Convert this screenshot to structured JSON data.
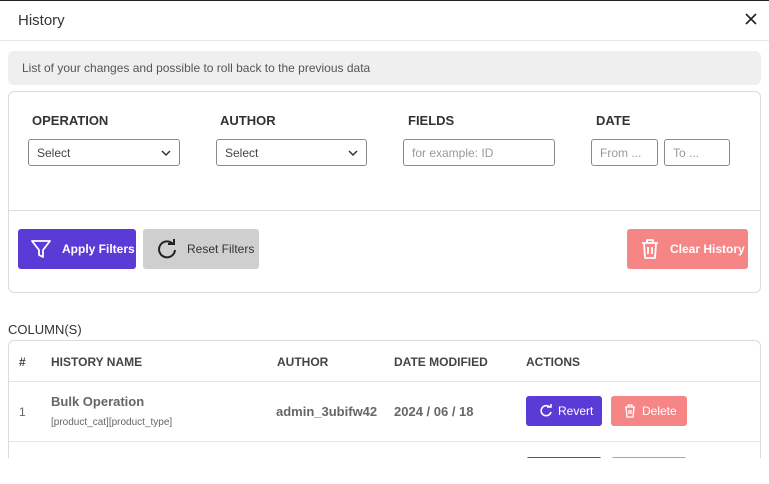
{
  "dialog": {
    "title": "History",
    "info": "List of your changes and possible to roll back to the previous data"
  },
  "filters": {
    "operation_label": "OPERATION",
    "operation_value": "Select",
    "author_label": "AUTHOR",
    "author_value": "Select",
    "fields_label": "FIELDS",
    "fields_placeholder": "for example: ID",
    "date_label": "DATE",
    "date_from_placeholder": "From ...",
    "date_to_placeholder": "To ...",
    "apply_label": "Apply Filters",
    "reset_label": "Reset Filters",
    "clear_label": "Clear History"
  },
  "table": {
    "section_title": "COLUMN(S)",
    "headers": {
      "index": "#",
      "name": "HISTORY NAME",
      "author": "AUTHOR",
      "date": "DATE MODIFIED",
      "actions": "ACTIONS"
    },
    "rows": [
      {
        "index": "1",
        "name": "Bulk Operation",
        "fields": "[product_cat][product_type]",
        "author": "admin_3ubifw42",
        "date": "2024 / 06 / 18",
        "revert_label": "Revert",
        "delete_label": "Delete"
      }
    ]
  },
  "colors": {
    "primary": "#5b3bd6",
    "danger": "#f68585",
    "neutral": "#cfcfcf"
  },
  "icons": {
    "close": "close-icon",
    "chevron": "chevron-down-icon",
    "filter": "filter-icon",
    "reset": "refresh-icon",
    "trash": "trash-icon"
  }
}
